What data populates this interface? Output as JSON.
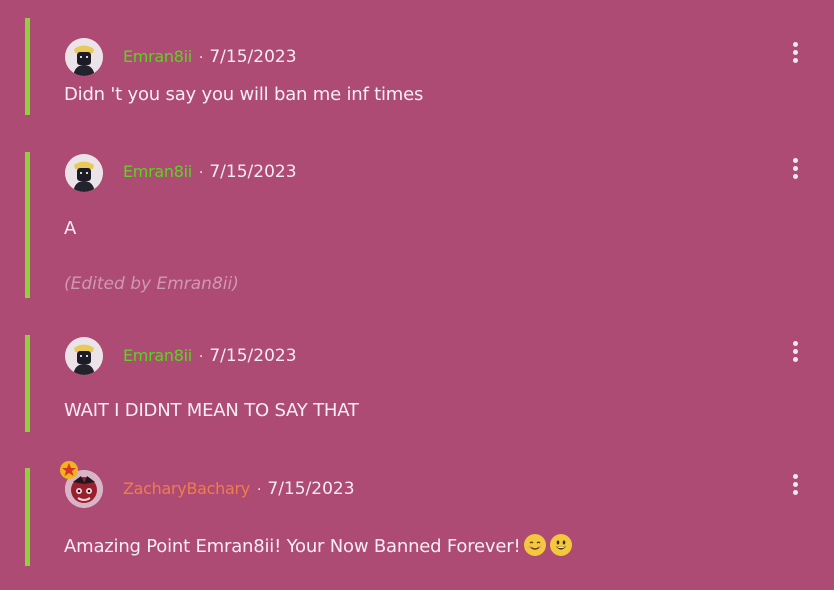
{
  "colors": {
    "background": "#ad4b74",
    "thread_bar": "#8fd13d",
    "username_green": "#5ad61c",
    "username_orange": "#f07c4b",
    "text": "#f8eef3",
    "edited_text": "#cf98b6"
  },
  "comments": [
    {
      "username": "Emran8ii",
      "separator": "·",
      "date": "7/15/2023",
      "body": "Didn 't you say you will ban me inf times",
      "avatar_icon": "dark-figure-avatar",
      "menu_icon": "more-vertical-icon"
    },
    {
      "username": "Emran8ii",
      "separator": "·",
      "date": "7/15/2023",
      "body": "A",
      "edited": "(Edited by Emran8ii)",
      "avatar_icon": "dark-figure-avatar",
      "menu_icon": "more-vertical-icon"
    },
    {
      "username": "Emran8ii",
      "separator": "·",
      "date": "7/15/2023",
      "body": "WAIT I DIDNT MEAN TO SAY THAT",
      "avatar_icon": "dark-figure-avatar",
      "menu_icon": "more-vertical-icon"
    },
    {
      "username": "ZacharyBachary",
      "separator": "·",
      "date": "7/15/2023",
      "body": "Amazing Point Emran8ii! Your Now Banned Forever!",
      "emojis": [
        "smiling-face-emoji",
        "grinning-face-emoji"
      ],
      "avatar_icon": "red-character-avatar",
      "badge_icon": "star-badge-icon",
      "menu_icon": "more-vertical-icon"
    }
  ]
}
